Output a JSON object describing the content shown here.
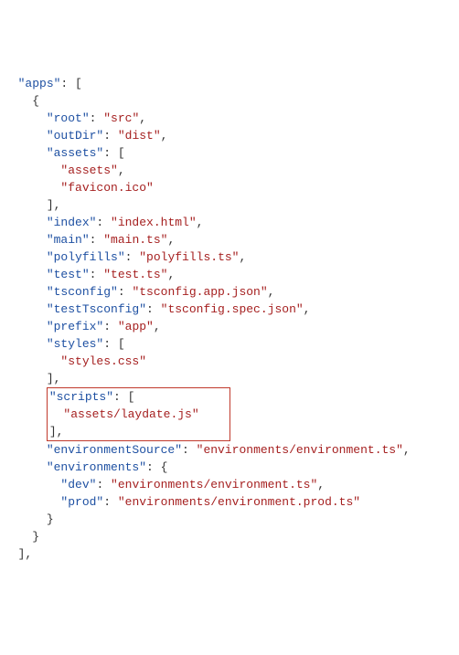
{
  "code": {
    "apps_key": "\"apps\"",
    "root_key": "\"root\"",
    "root_val": "\"src\"",
    "outDir_key": "\"outDir\"",
    "outDir_val": "\"dist\"",
    "assets_key": "\"assets\"",
    "assets_items": [
      "\"assets\"",
      "\"favicon.ico\""
    ],
    "index_key": "\"index\"",
    "index_val": "\"index.html\"",
    "main_key": "\"main\"",
    "main_val": "\"main.ts\"",
    "polyfills_key": "\"polyfills\"",
    "polyfills_val": "\"polyfills.ts\"",
    "test_key": "\"test\"",
    "test_val": "\"test.ts\"",
    "tsconfig_key": "\"tsconfig\"",
    "tsconfig_val": "\"tsconfig.app.json\"",
    "testTsconfig_key": "\"testTsconfig\"",
    "testTsconfig_val": "\"tsconfig.spec.json\"",
    "prefix_key": "\"prefix\"",
    "prefix_val": "\"app\"",
    "styles_key": "\"styles\"",
    "styles_items": [
      "\"styles.css\""
    ],
    "scripts_key": "\"scripts\"",
    "scripts_items": [
      "\"assets/laydate.js\""
    ],
    "envSource_key": "\"environmentSource\"",
    "envSource_val": "\"environments/environment.ts\"",
    "environments_key": "\"environments\"",
    "env_dev_key": "\"dev\"",
    "env_dev_val": "\"environments/environment.ts\"",
    "env_prod_key": "\"prod\"",
    "env_prod_val": "\"environments/environment.prod.ts\""
  },
  "p": {
    "colon_sp": ": ",
    "comma": ",",
    "lbracket": "[",
    "rbracket": "]",
    "lbrace": "{",
    "rbrace": "}"
  }
}
